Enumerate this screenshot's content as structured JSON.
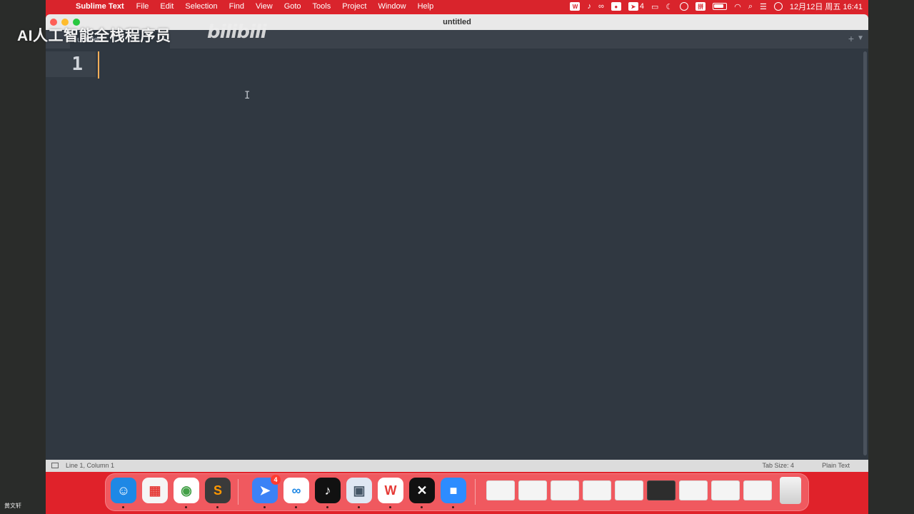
{
  "menubar": {
    "apple_glyph": "",
    "app_name": "Sublime Text",
    "menus": [
      "File",
      "Edit",
      "Selection",
      "Find",
      "View",
      "Goto",
      "Tools",
      "Project",
      "Window",
      "Help"
    ],
    "badge_count": "4",
    "ime_label": "拼",
    "clock": "12月12日 周五 16:41"
  },
  "window": {
    "title": "untitled",
    "tab_label": "untitled",
    "tab_plus": "+",
    "tab_menu": "▼"
  },
  "editor": {
    "line_number": "1",
    "cursor_glyph": "I"
  },
  "statusbar": {
    "position": "Line 1, Column 1",
    "tab_size": "Tab Size: 4",
    "syntax": "Plain Text"
  },
  "overlay": {
    "watermark": "AI人工智能全栈程序员",
    "logo_text": "bilibili",
    "corner_name": "黄文轩"
  },
  "dock": {
    "apps": [
      {
        "name": "Finder",
        "glyph": "☺",
        "color": "#1e88e5"
      },
      {
        "name": "Launchpad",
        "glyph": "▦",
        "color": "#f5f5f5"
      },
      {
        "name": "Chrome",
        "glyph": "◉",
        "color": "#ffffff"
      },
      {
        "name": "Sublime Text",
        "glyph": "S",
        "color": "#3a3a3a"
      },
      {
        "name": "Feishu",
        "glyph": "➤",
        "color": "#3b82f6"
      },
      {
        "name": "Baidu Netdisk",
        "glyph": "∞",
        "color": "#ffffff"
      },
      {
        "name": "TikTok",
        "glyph": "♪",
        "color": "#111111"
      },
      {
        "name": "Preview",
        "glyph": "▣",
        "color": "#dfe7f3"
      },
      {
        "name": "WPS",
        "glyph": "W",
        "color": "#ffffff"
      },
      {
        "name": "CapCut",
        "glyph": "✕",
        "color": "#111111"
      },
      {
        "name": "Zoom",
        "glyph": "■",
        "color": "#2d8cff"
      }
    ],
    "feishu_badge": "4"
  }
}
